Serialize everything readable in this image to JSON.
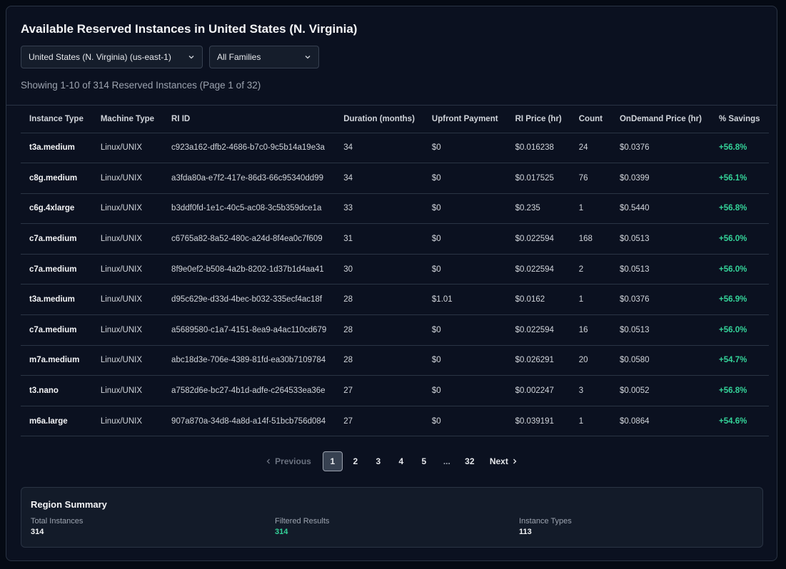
{
  "title": "Available Reserved Instances in United States (N. Virginia)",
  "filters": {
    "region": "United States (N. Virginia) (us-east-1)",
    "family": "All Families"
  },
  "showing": "Showing 1-10 of 314 Reserved Instances (Page 1 of 32)",
  "table": {
    "headers": [
      "Instance Type",
      "Machine Type",
      "RI ID",
      "Duration (months)",
      "Upfront Payment",
      "RI Price (hr)",
      "Count",
      "OnDemand Price (hr)",
      "% Savings"
    ],
    "rows": [
      [
        "t3a.medium",
        "Linux/UNIX",
        "c923a162-dfb2-4686-b7c0-9c5b14a19e3a",
        "34",
        "$0",
        "$0.016238",
        "24",
        "$0.0376",
        "+56.8%"
      ],
      [
        "c8g.medium",
        "Linux/UNIX",
        "a3fda80a-e7f2-417e-86d3-66c95340dd99",
        "34",
        "$0",
        "$0.017525",
        "76",
        "$0.0399",
        "+56.1%"
      ],
      [
        "c6g.4xlarge",
        "Linux/UNIX",
        "b3ddf0fd-1e1c-40c5-ac08-3c5b359dce1a",
        "33",
        "$0",
        "$0.235",
        "1",
        "$0.5440",
        "+56.8%"
      ],
      [
        "c7a.medium",
        "Linux/UNIX",
        "c6765a82-8a52-480c-a24d-8f4ea0c7f609",
        "31",
        "$0",
        "$0.022594",
        "168",
        "$0.0513",
        "+56.0%"
      ],
      [
        "c7a.medium",
        "Linux/UNIX",
        "8f9e0ef2-b508-4a2b-8202-1d37b1d4aa41",
        "30",
        "$0",
        "$0.022594",
        "2",
        "$0.0513",
        "+56.0%"
      ],
      [
        "t3a.medium",
        "Linux/UNIX",
        "d95c629e-d33d-4bec-b032-335ecf4ac18f",
        "28",
        "$1.01",
        "$0.0162",
        "1",
        "$0.0376",
        "+56.9%"
      ],
      [
        "c7a.medium",
        "Linux/UNIX",
        "a5689580-c1a7-4151-8ea9-a4ac110cd679",
        "28",
        "$0",
        "$0.022594",
        "16",
        "$0.0513",
        "+56.0%"
      ],
      [
        "m7a.medium",
        "Linux/UNIX",
        "abc18d3e-706e-4389-81fd-ea30b7109784",
        "28",
        "$0",
        "$0.026291",
        "20",
        "$0.0580",
        "+54.7%"
      ],
      [
        "t3.nano",
        "Linux/UNIX",
        "a7582d6e-bc27-4b1d-adfe-c264533ea36e",
        "27",
        "$0",
        "$0.002247",
        "3",
        "$0.0052",
        "+56.8%"
      ],
      [
        "m6a.large",
        "Linux/UNIX",
        "907a870a-34d8-4a8d-a14f-51bcb756d084",
        "27",
        "$0",
        "$0.039191",
        "1",
        "$0.0864",
        "+54.6%"
      ]
    ]
  },
  "pagination": {
    "previous": "Previous",
    "pages": [
      "1",
      "2",
      "3",
      "4",
      "5",
      "...",
      "32"
    ],
    "current": "1",
    "next": "Next"
  },
  "summary": {
    "title": "Region Summary",
    "total_label": "Total Instances",
    "total_value": "314",
    "filtered_label": "Filtered Results",
    "filtered_value": "314",
    "types_label": "Instance Types",
    "types_value": "113"
  },
  "colors": {
    "savings": "#34d399",
    "background": "#0b1120"
  }
}
